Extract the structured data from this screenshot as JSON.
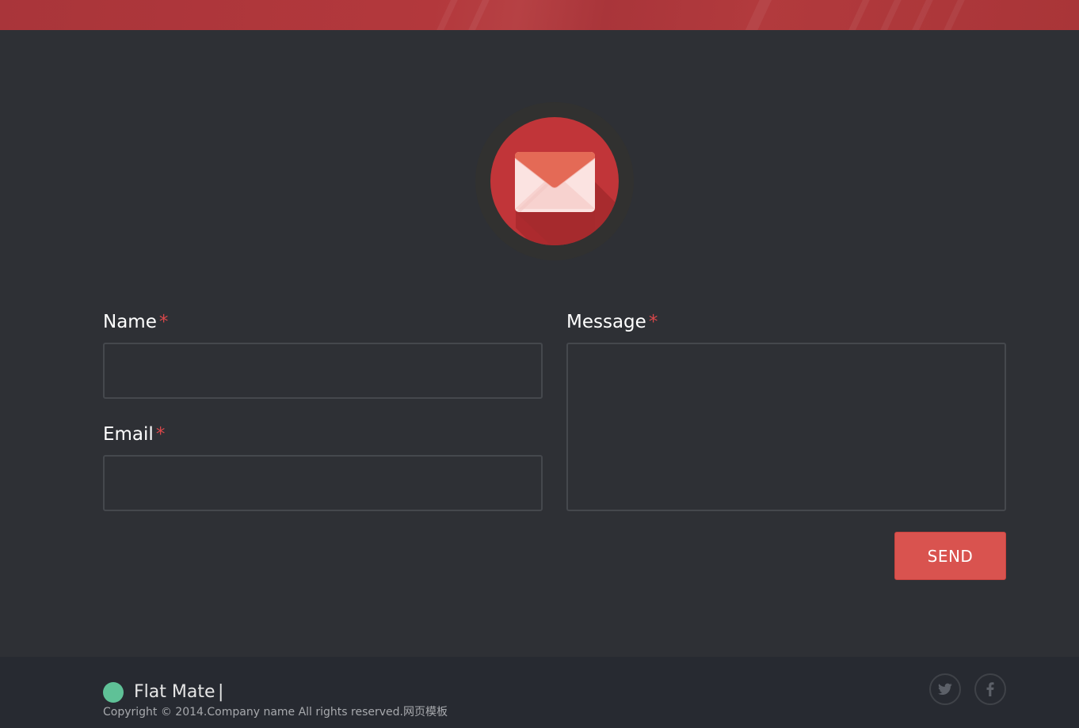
{
  "contact": {
    "form": {
      "name_label": "Name",
      "email_label": "Email",
      "message_label": "Message",
      "required_mark": "*",
      "name_value": "",
      "email_value": "",
      "message_value": "",
      "send_label": "SEND"
    },
    "colors": {
      "accent": "#d9534f",
      "required": "#d9474a",
      "background": "#2e3035"
    },
    "icon": "envelope-icon"
  },
  "footer": {
    "brand_name": "Flat Mate",
    "brand_separator": "|",
    "copyright": "Copyright © 2014.Company name All rights reserved.网页模板",
    "brand_color": "#5fc197",
    "social": [
      "twitter-icon",
      "facebook-icon"
    ]
  }
}
